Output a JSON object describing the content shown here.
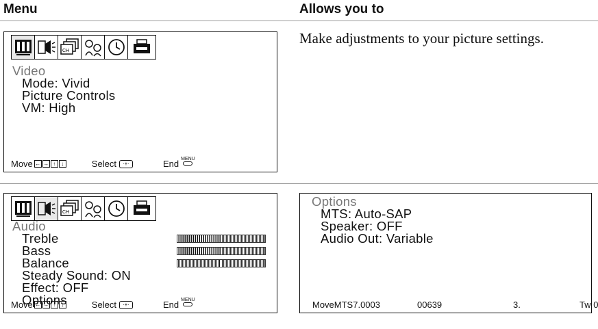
{
  "header": {
    "menu": "Menu",
    "allows": "Allows you to"
  },
  "video": {
    "title": "Video",
    "items": [
      "Mode:  Vivid",
      "Picture Controls",
      "VM: High"
    ],
    "description": "Make adjustments to your picture settings."
  },
  "audio": {
    "title": "Audio",
    "items": [
      "Treble",
      "Bass",
      "Balance",
      "Steady Sound:  ON",
      "Effect:  OFF",
      "Options"
    ],
    "levels": {
      "treble": 0.5,
      "bass": 0.5,
      "balance": 0.5
    }
  },
  "options": {
    "title": "Options",
    "items": [
      "MTS:  Auto-SAP",
      "Speaker:  OFF",
      "Audio Out: Variable"
    ],
    "footer": [
      "MoveMTS7.0003",
      "00639",
      "3.",
      "Tw 0"
    ]
  },
  "footer": {
    "move": "Move",
    "select": "Select",
    "end": "End",
    "menu_key": "MENU"
  },
  "icons": [
    "video-icon",
    "audio-icon",
    "channel-icon",
    "parental-icon",
    "timer-icon",
    "setup-icon"
  ]
}
